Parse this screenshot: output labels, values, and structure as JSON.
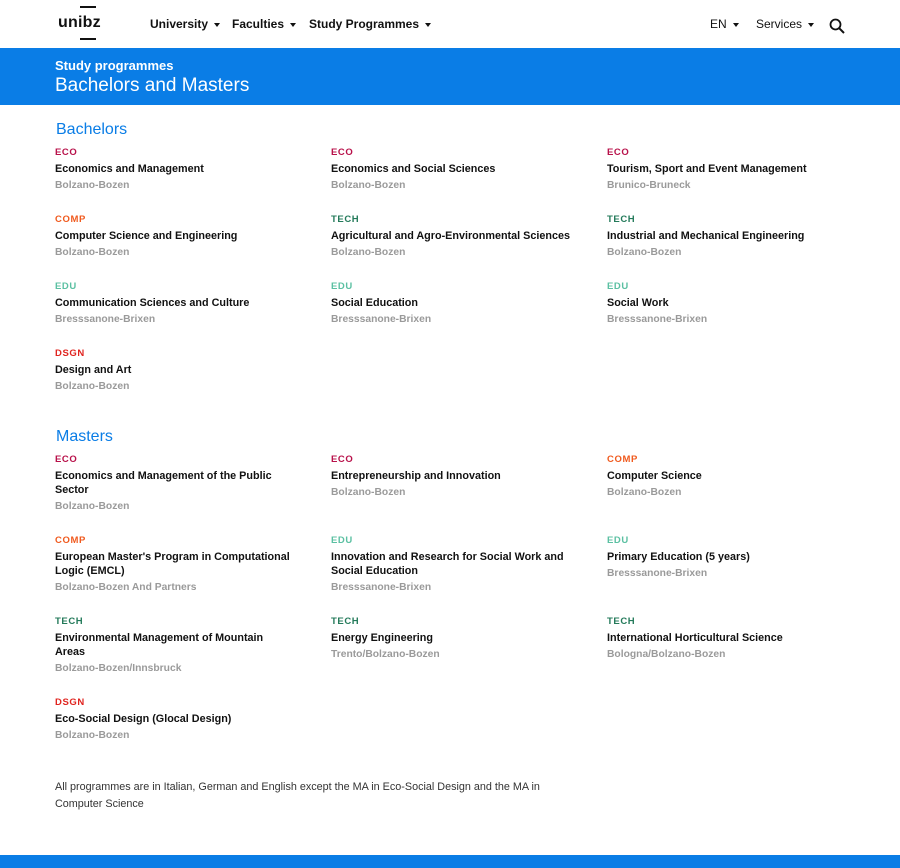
{
  "header": {
    "logo": "unibz",
    "nav": [
      {
        "label": "University"
      },
      {
        "label": "Faculties"
      },
      {
        "label": "Study Programmes"
      }
    ],
    "lang": "EN",
    "services": "Services"
  },
  "band": {
    "kicker": "Study programmes",
    "title": "Bachelors and Masters"
  },
  "bachelors": {
    "title": "Bachelors",
    "items": [
      {
        "tag": "ECO",
        "name": "Economics and Management",
        "location": "Bolzano-Bozen"
      },
      {
        "tag": "ECO",
        "name": "Economics and Social Sciences",
        "location": "Bolzano-Bozen"
      },
      {
        "tag": "ECO",
        "name": "Tourism, Sport and Event Management",
        "location": "Brunico-Bruneck"
      },
      {
        "tag": "COMP",
        "name": "Computer Science and Engineering",
        "location": "Bolzano-Bozen"
      },
      {
        "tag": "TECH",
        "name": "Agricultural and Agro-Environmental Sciences",
        "location": "Bolzano-Bozen"
      },
      {
        "tag": "TECH",
        "name": "Industrial and Mechanical Engineering",
        "location": "Bolzano-Bozen"
      },
      {
        "tag": "EDU",
        "name": "Communication Sciences and Culture",
        "location": "Bresssanone-Brixen"
      },
      {
        "tag": "EDU",
        "name": "Social Education",
        "location": "Bresssanone-Brixen"
      },
      {
        "tag": "EDU",
        "name": "Social Work",
        "location": "Bresssanone-Brixen"
      },
      {
        "tag": "DSGN",
        "name": "Design and Art",
        "location": "Bolzano-Bozen"
      }
    ]
  },
  "masters": {
    "title": "Masters",
    "items": [
      {
        "tag": "ECO",
        "name": "Economics and Management of the Public Sector",
        "location": "Bolzano-Bozen"
      },
      {
        "tag": "ECO",
        "name": "Entrepreneurship and Innovation",
        "location": "Bolzano-Bozen"
      },
      {
        "tag": "COMP",
        "name": "Computer Science",
        "location": "Bolzano-Bozen"
      },
      {
        "tag": "COMP",
        "name": "European Master's Program in Computational Logic (EMCL)",
        "location": "Bolzano-Bozen And Partners"
      },
      {
        "tag": "EDU",
        "name": "Innovation and Research for Social Work and Social Education",
        "location": "Bresssanone-Brixen"
      },
      {
        "tag": "EDU",
        "name": "Primary Education (5 years)",
        "location": "Bresssanone-Brixen"
      },
      {
        "tag": "TECH",
        "name": "Environmental Management of Mountain Areas",
        "location": "Bolzano-Bozen/Innsbruck"
      },
      {
        "tag": "TECH",
        "name": "Energy Engineering",
        "location": "Trento/Bolzano-Bozen"
      },
      {
        "tag": "TECH",
        "name": "International Horticultural Science",
        "location": "Bologna/Bolzano-Bozen"
      },
      {
        "tag": "DSGN",
        "name": "Eco-Social Design (Glocal Design)",
        "location": "Bolzano-Bozen"
      }
    ]
  },
  "note": "All programmes are in Italian, German and English except the MA in Eco-Social Design and the MA in Computer Science",
  "tag_colors": {
    "ECO": "#b8114a",
    "COMP": "#f05a1e",
    "TECH": "#237a5a",
    "EDU": "#5bc0a2",
    "DSGN": "#e0241f"
  },
  "accent": "#0a7de6"
}
